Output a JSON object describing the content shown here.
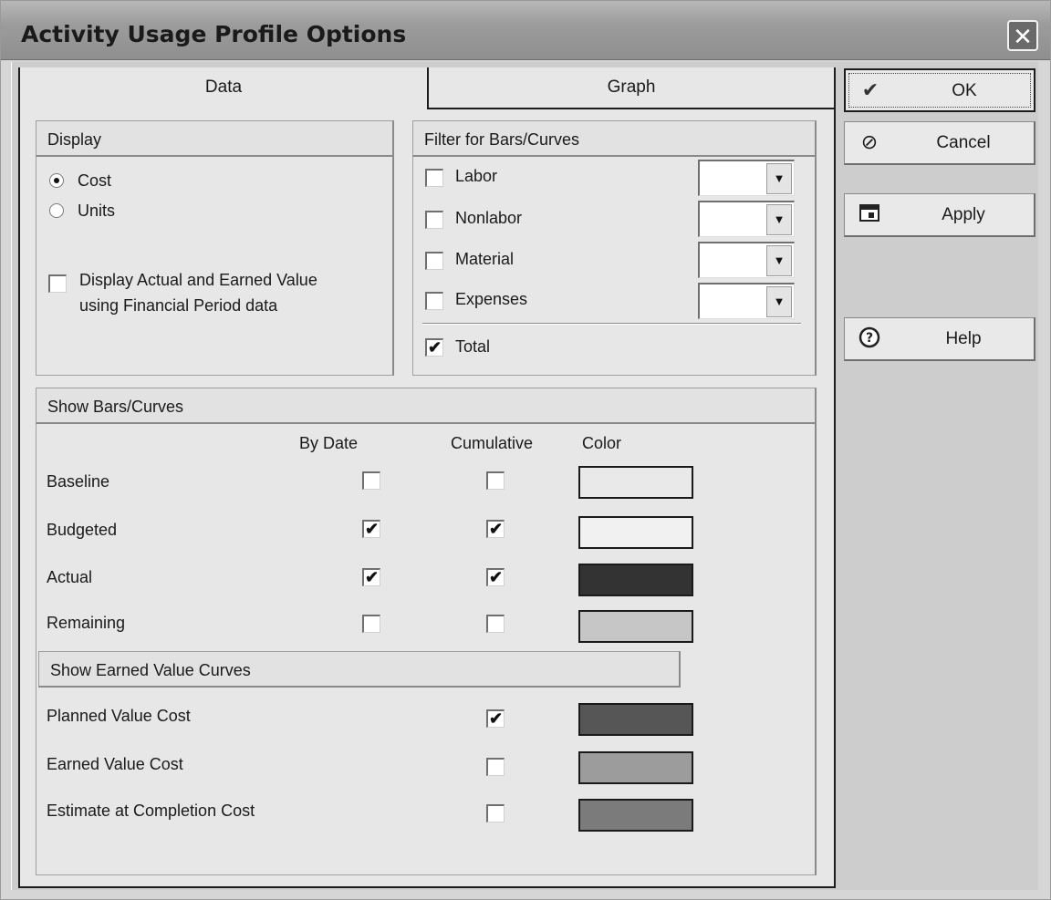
{
  "window": {
    "title": "Activity Usage Profile Options",
    "close_label": "✕"
  },
  "tabs": {
    "data": "Data",
    "graph": "Graph"
  },
  "display": {
    "header": "Display",
    "cost": "Cost",
    "units": "Units",
    "selected": "Cost",
    "financial_line1": "Display Actual and Earned Value",
    "financial_line2": "using Financial Period data",
    "financial_checked": false
  },
  "filter": {
    "header": "Filter for Bars/Curves",
    "labor": "Labor",
    "nonlabor": "Nonlabor",
    "material": "Material",
    "expenses": "Expenses",
    "total": "Total",
    "total_checked": true,
    "dropdown_values": [
      "",
      "",
      "",
      ""
    ]
  },
  "bars": {
    "header": "Show Bars/Curves",
    "col_bydate": "By Date",
    "col_cumulative": "Cumulative",
    "col_color": "Color",
    "rows": [
      {
        "label": "Baseline",
        "by_date": false,
        "cumulative": false,
        "color": "#e9e9e9"
      },
      {
        "label": "Budgeted",
        "by_date": true,
        "cumulative": true,
        "color": "#f1f1f1"
      },
      {
        "label": "Actual",
        "by_date": true,
        "cumulative": true,
        "color": "#333333"
      },
      {
        "label": "Remaining",
        "by_date": false,
        "cumulative": false,
        "color": "#c6c6c6"
      }
    ]
  },
  "earned": {
    "header": "Show Earned Value Curves",
    "rows": [
      {
        "label": "Planned Value Cost",
        "cumulative": true,
        "color": "#565656"
      },
      {
        "label": "Earned Value Cost",
        "cumulative": false,
        "color": "#9c9c9c"
      },
      {
        "label": "Estimate at Completion Cost",
        "cumulative": false,
        "color": "#7b7b7b"
      }
    ]
  },
  "buttons": {
    "ok": "OK",
    "cancel": "Cancel",
    "apply": "Apply",
    "help": "Help"
  },
  "checkmark": "✔",
  "icons": {
    "ok": "checkmark-icon",
    "cancel": "cancel-icon",
    "apply": "apply-icon",
    "help": "help-icon"
  }
}
